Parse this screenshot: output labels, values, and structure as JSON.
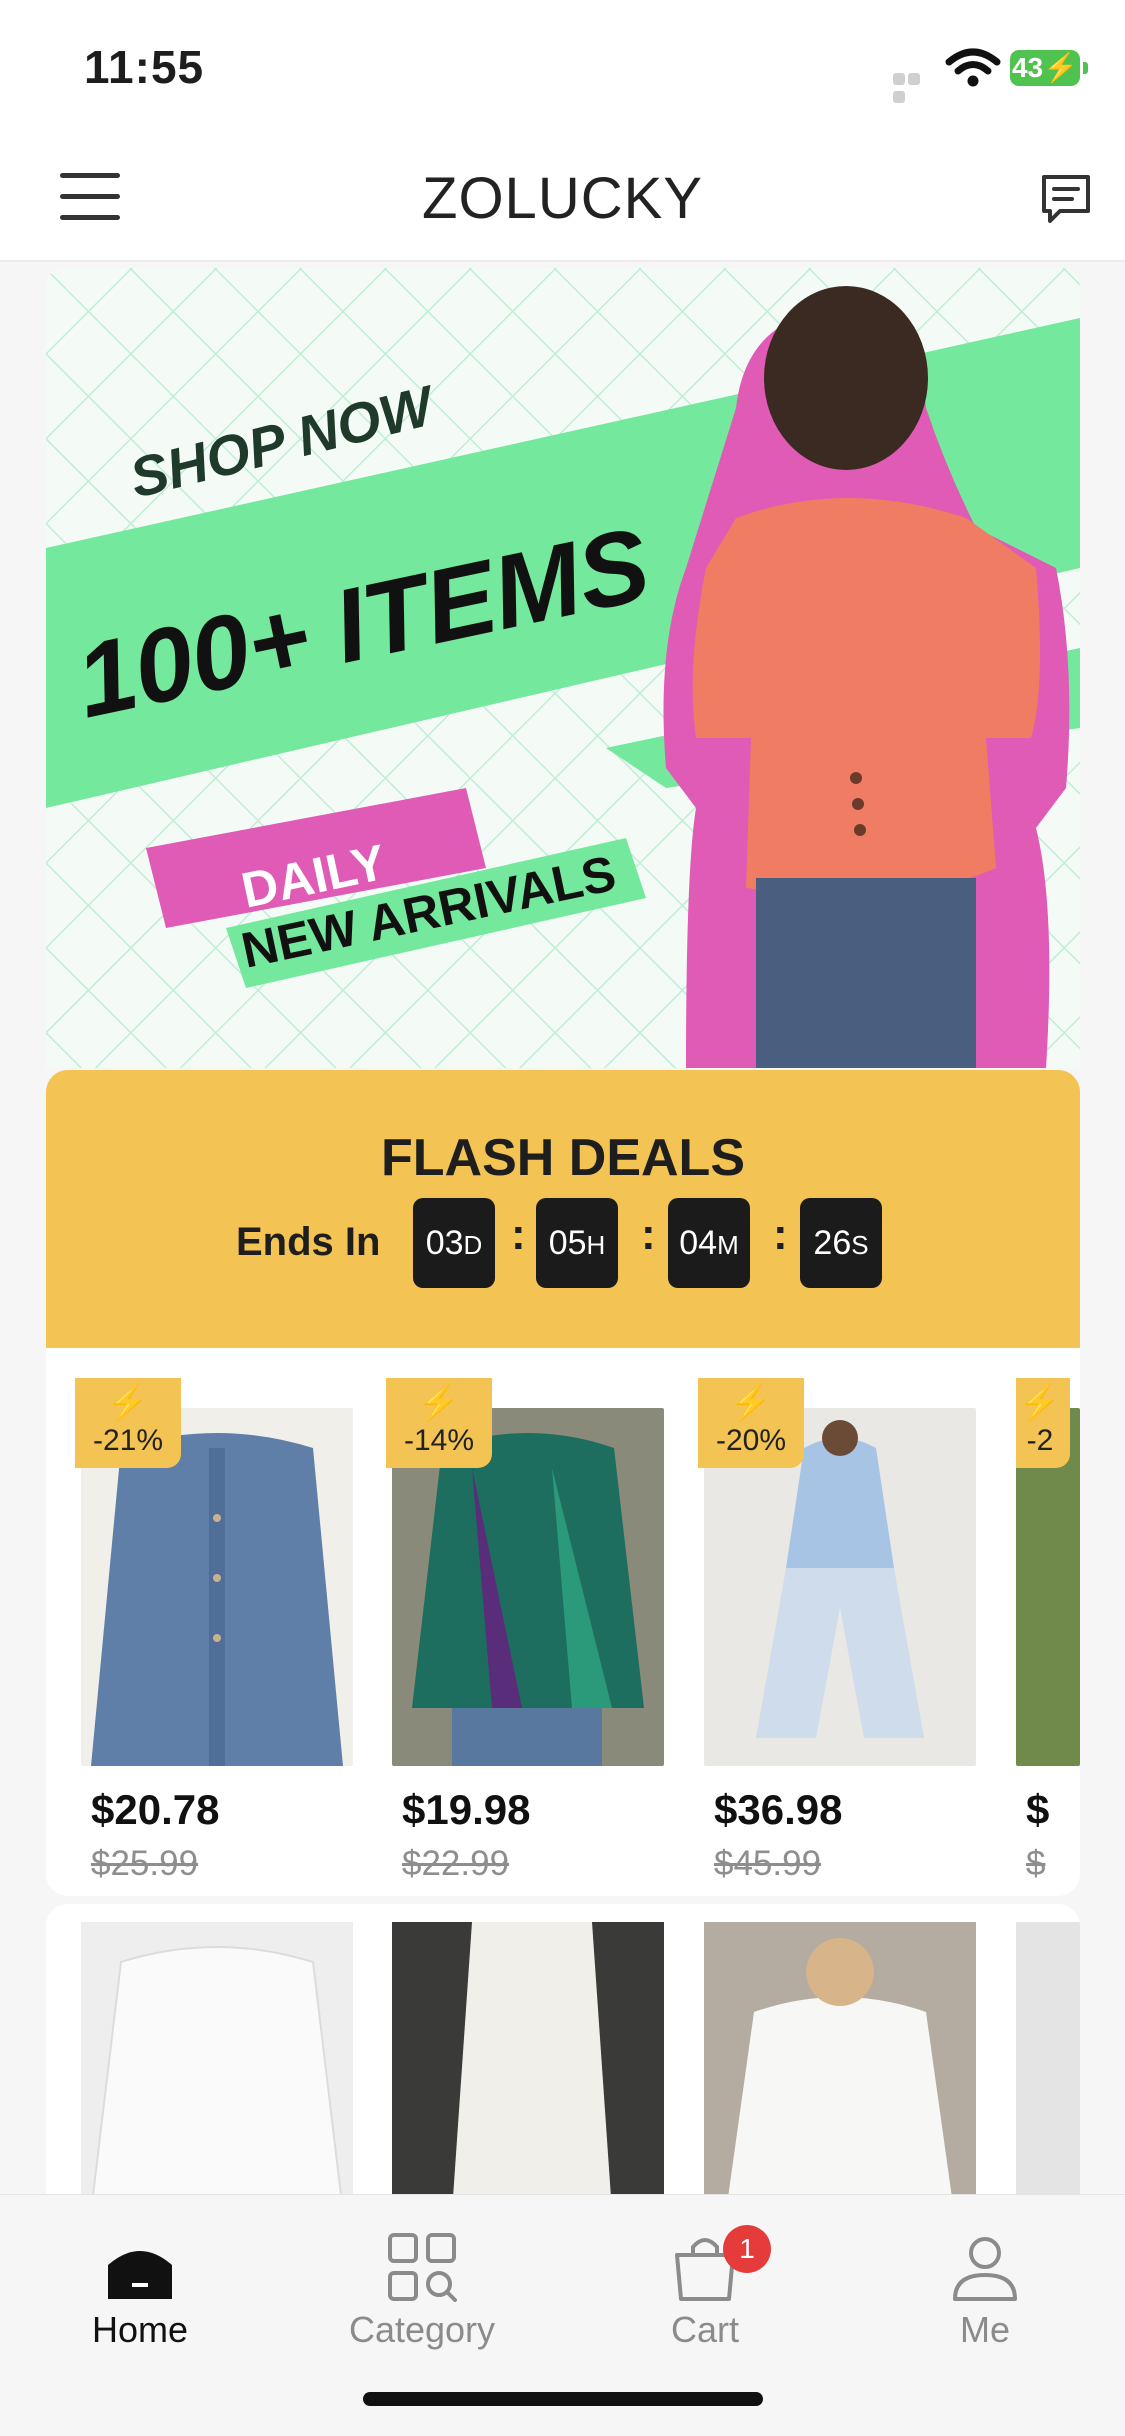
{
  "status_bar": {
    "time": "11:55",
    "battery": "43"
  },
  "header": {
    "brand": "ZOLUCKY"
  },
  "banner": {
    "line1": "SHOP NOW",
    "line2": "100+ ITEMS",
    "line3": "DAILY",
    "line4": "NEW ARRIVALS"
  },
  "flash_deals": {
    "title": "FLASH DEALS",
    "ends_label": "Ends In",
    "timer": [
      {
        "value": "03",
        "unit": "D"
      },
      {
        "value": "05",
        "unit": "H"
      },
      {
        "value": "04",
        "unit": "M"
      },
      {
        "value": "26",
        "unit": "S"
      }
    ]
  },
  "products": [
    {
      "discount": "-21%",
      "price": "$20.78",
      "old_price": "$25.99"
    },
    {
      "discount": "-14%",
      "price": "$19.98",
      "old_price": "$22.99"
    },
    {
      "discount": "-20%",
      "price": "$36.98",
      "old_price": "$45.99"
    },
    {
      "discount": "-2",
      "price": "$",
      "old_price": "$"
    }
  ],
  "tabs": [
    {
      "label": "Home",
      "icon": "home-icon"
    },
    {
      "label": "Category",
      "icon": "category-icon"
    },
    {
      "label": "Cart",
      "icon": "cart-icon",
      "badge": "1"
    },
    {
      "label": "Me",
      "icon": "person-icon"
    }
  ],
  "colors": {
    "accent": "#f3c353",
    "banner_green": "#74e89c",
    "banner_pink": "#e05bb5",
    "badge_red": "#e63b3b"
  }
}
